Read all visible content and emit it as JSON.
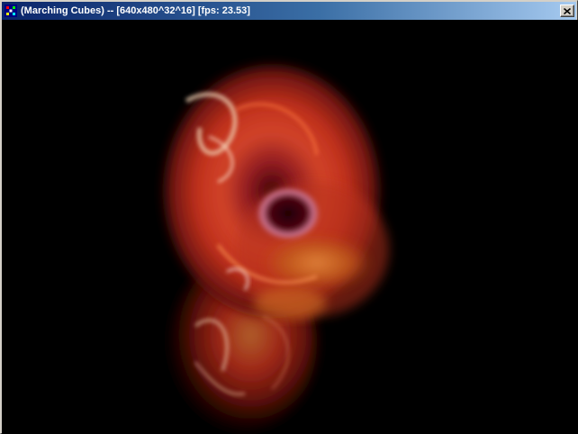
{
  "window": {
    "title": "(Marching Cubes) -- [640x480^32^16] [fps: 23.53]"
  },
  "icons": {
    "app": "app-icon",
    "close": "close-icon"
  },
  "colors": {
    "title_active_start": "#0a246a",
    "title_active_end": "#a6caf0",
    "viewport_background": "#000000",
    "blob_primary": "#c8321e",
    "blob_highlight": "#f0d2b4",
    "blob_amber": "#d2781e"
  }
}
